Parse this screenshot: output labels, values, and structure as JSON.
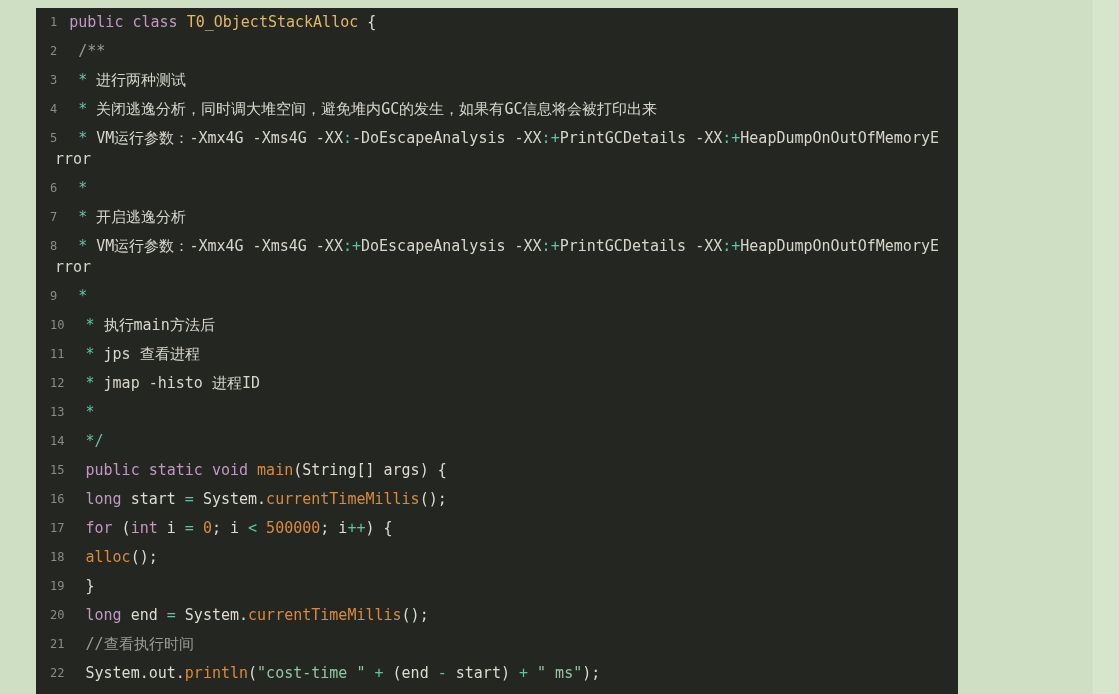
{
  "code_block": {
    "lines": [
      {
        "number": "1",
        "tokens": [
          {
            "kind": "keyword",
            "text": "public"
          },
          {
            "kind": "keyword",
            "text": " class"
          },
          {
            "kind": "class",
            "text": " T0_ObjectStackAlloc"
          },
          {
            "kind": "plain",
            "text": " {"
          }
        ]
      },
      {
        "number": "2",
        "tokens": [
          {
            "kind": "comment",
            "text": " /**"
          }
        ]
      },
      {
        "number": "3",
        "tokens": [
          {
            "kind": "star",
            "text": " *"
          },
          {
            "kind": "doc",
            "text": " 进行两种测试"
          }
        ]
      },
      {
        "number": "4",
        "tokens": [
          {
            "kind": "star",
            "text": " *"
          },
          {
            "kind": "doc",
            "text": " 关闭逃逸分析，同时调大堆空间，避免堆内GC的发生，如果有GC信息将会被打印出来"
          }
        ]
      },
      {
        "number": "5",
        "tokens": [
          {
            "kind": "star",
            "text": " *"
          },
          {
            "kind": "doc",
            "text": " VM运行参数：-Xmx4G -Xms4G -XX"
          },
          {
            "kind": "op",
            "text": ":"
          },
          {
            "kind": "doc",
            "text": "-DoEscapeAnalysis -XX"
          },
          {
            "kind": "op",
            "text": ":+"
          },
          {
            "kind": "doc",
            "text": "PrintGCDetails -XX"
          },
          {
            "kind": "op",
            "text": ":+"
          },
          {
            "kind": "doc",
            "text": "HeapDumpOnOutOfMemoryE"
          }
        ],
        "wrap": "rror"
      },
      {
        "number": "6",
        "tokens": [
          {
            "kind": "star",
            "text": " *"
          }
        ]
      },
      {
        "number": "7",
        "tokens": [
          {
            "kind": "star",
            "text": " *"
          },
          {
            "kind": "doc",
            "text": " 开启逃逸分析"
          }
        ]
      },
      {
        "number": "8",
        "tokens": [
          {
            "kind": "star",
            "text": " *"
          },
          {
            "kind": "doc",
            "text": " VM运行参数：-Xmx4G -Xms4G -XX"
          },
          {
            "kind": "op",
            "text": ":+"
          },
          {
            "kind": "doc",
            "text": "DoEscapeAnalysis -XX"
          },
          {
            "kind": "op",
            "text": ":+"
          },
          {
            "kind": "doc",
            "text": "PrintGCDetails -XX"
          },
          {
            "kind": "op",
            "text": ":+"
          },
          {
            "kind": "doc",
            "text": "HeapDumpOnOutOfMemoryE"
          }
        ],
        "wrap": "rror"
      },
      {
        "number": "9",
        "tokens": [
          {
            "kind": "star",
            "text": " *"
          }
        ]
      },
      {
        "number": "10",
        "tokens": [
          {
            "kind": "star",
            "text": " *"
          },
          {
            "kind": "doc",
            "text": " 执行main方法后"
          }
        ]
      },
      {
        "number": "11",
        "tokens": [
          {
            "kind": "star",
            "text": " *"
          },
          {
            "kind": "doc",
            "text": " jps 查看进程"
          }
        ]
      },
      {
        "number": "12",
        "tokens": [
          {
            "kind": "star",
            "text": " *"
          },
          {
            "kind": "doc",
            "text": " jmap -histo 进程ID"
          }
        ]
      },
      {
        "number": "13",
        "tokens": [
          {
            "kind": "star",
            "text": " *"
          }
        ]
      },
      {
        "number": "14",
        "tokens": [
          {
            "kind": "star",
            "text": " */"
          }
        ]
      },
      {
        "number": "15",
        "tokens": [
          {
            "kind": "keyword",
            "text": " public"
          },
          {
            "kind": "keyword",
            "text": " static"
          },
          {
            "kind": "keyword",
            "text": " void"
          },
          {
            "kind": "function",
            "text": " main"
          },
          {
            "kind": "plain",
            "text": "(String[] args) {"
          }
        ]
      },
      {
        "number": "16",
        "tokens": [
          {
            "kind": "keyword",
            "text": " long"
          },
          {
            "kind": "plain",
            "text": " start "
          },
          {
            "kind": "op",
            "text": "="
          },
          {
            "kind": "plain",
            "text": " System."
          },
          {
            "kind": "function",
            "text": "currentTimeMillis"
          },
          {
            "kind": "plain",
            "text": "();"
          }
        ]
      },
      {
        "number": "17",
        "tokens": [
          {
            "kind": "keyword",
            "text": " for"
          },
          {
            "kind": "plain",
            "text": " ("
          },
          {
            "kind": "keyword",
            "text": "int"
          },
          {
            "kind": "plain",
            "text": " i "
          },
          {
            "kind": "op",
            "text": "="
          },
          {
            "kind": "number",
            "text": " 0"
          },
          {
            "kind": "plain",
            "text": "; i "
          },
          {
            "kind": "op",
            "text": "<"
          },
          {
            "kind": "number",
            "text": " 500000"
          },
          {
            "kind": "plain",
            "text": "; i"
          },
          {
            "kind": "op",
            "text": "++"
          },
          {
            "kind": "plain",
            "text": ") {"
          }
        ]
      },
      {
        "number": "18",
        "tokens": [
          {
            "kind": "function",
            "text": " alloc"
          },
          {
            "kind": "plain",
            "text": "();"
          }
        ]
      },
      {
        "number": "19",
        "tokens": [
          {
            "kind": "plain",
            "text": " }"
          }
        ]
      },
      {
        "number": "20",
        "tokens": [
          {
            "kind": "keyword",
            "text": " long"
          },
          {
            "kind": "plain",
            "text": " end "
          },
          {
            "kind": "op",
            "text": "="
          },
          {
            "kind": "plain",
            "text": " System."
          },
          {
            "kind": "function",
            "text": "currentTimeMillis"
          },
          {
            "kind": "plain",
            "text": "();"
          }
        ]
      },
      {
        "number": "21",
        "tokens": [
          {
            "kind": "comment",
            "text": " //查看执行时间"
          }
        ]
      },
      {
        "number": "22",
        "tokens": [
          {
            "kind": "plain",
            "text": " System.out."
          },
          {
            "kind": "function",
            "text": "println"
          },
          {
            "kind": "plain",
            "text": "("
          },
          {
            "kind": "string",
            "text": "\"cost-time \""
          },
          {
            "kind": "op",
            "text": " +"
          },
          {
            "kind": "plain",
            "text": " (end "
          },
          {
            "kind": "op",
            "text": "-"
          },
          {
            "kind": "plain",
            "text": " start) "
          },
          {
            "kind": "op",
            "text": "+"
          },
          {
            "kind": "string",
            "text": " \" ms\""
          },
          {
            "kind": "plain",
            "text": ");"
          }
        ]
      }
    ]
  }
}
